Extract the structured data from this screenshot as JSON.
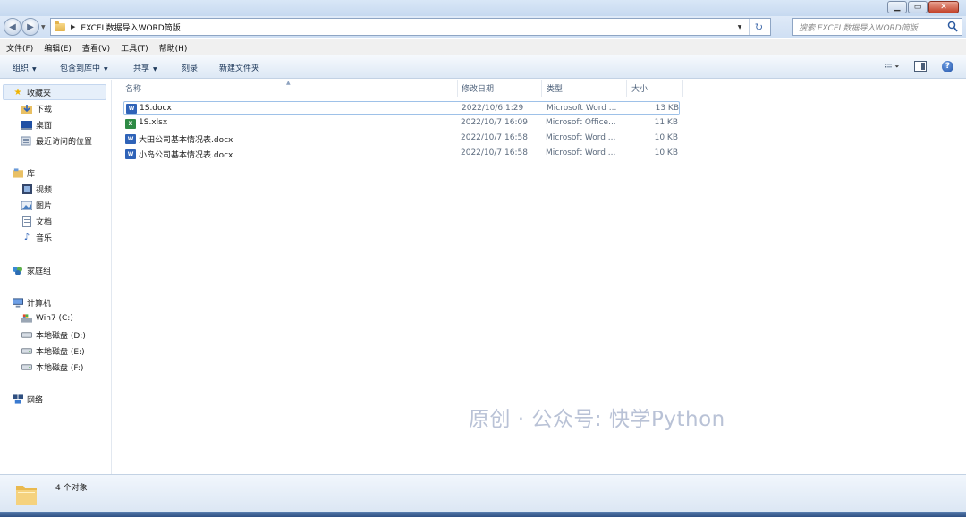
{
  "window": {
    "controls": [
      "minimize",
      "maximize",
      "close"
    ]
  },
  "address": {
    "path": [
      "EXCEL数据导入WORD简版"
    ],
    "search_placeholder": "搜索 EXCEL数据导入WORD简版"
  },
  "menu": [
    "文件(F)",
    "编辑(E)",
    "查看(V)",
    "工具(T)",
    "帮助(H)"
  ],
  "toolbar": {
    "organize": "组织",
    "include_in_library": "包含到库中",
    "share": "共享",
    "burn": "刻录",
    "new_folder": "新建文件夹"
  },
  "nav": {
    "favorites": "收藏夹",
    "favorites_items": [
      "下载",
      "桌面",
      "最近访问的位置"
    ],
    "libraries": "库",
    "library_items": [
      "视频",
      "图片",
      "文档",
      "音乐"
    ],
    "homegroup": "家庭组",
    "computer": "计算机",
    "computer_items": [
      "Win7 (C:)",
      "本地磁盘 (D:)",
      "本地磁盘 (E:)",
      "本地磁盘 (F:)"
    ],
    "network": "网络"
  },
  "columns": {
    "name": "名称",
    "modified": "修改日期",
    "type": "类型",
    "size": "大小"
  },
  "files": [
    {
      "name": "1S.docx",
      "modified": "2022/10/6 1:29",
      "type": "Microsoft Word ...",
      "size": "13 KB",
      "icon": "word-doc-icon"
    },
    {
      "name": "1S.xlsx",
      "modified": "2022/10/7 16:09",
      "type": "Microsoft Office...",
      "size": "11 KB",
      "icon": "excel-doc-icon"
    },
    {
      "name": "大田公司基本情况表.docx",
      "modified": "2022/10/7 16:58",
      "type": "Microsoft Word ...",
      "size": "10 KB",
      "icon": "word-doc-icon"
    },
    {
      "name": "小岛公司基本情况表.docx",
      "modified": "2022/10/7 16:58",
      "type": "Microsoft Word ...",
      "size": "10 KB",
      "icon": "word-doc-icon"
    }
  ],
  "watermark": "原创 · 公众号: 快学Python",
  "status": {
    "count": "4 个对象"
  },
  "colors": {
    "accent": "#1e395b",
    "selection_border": "#9ec1e8",
    "watermark": "#b9c2d6"
  }
}
